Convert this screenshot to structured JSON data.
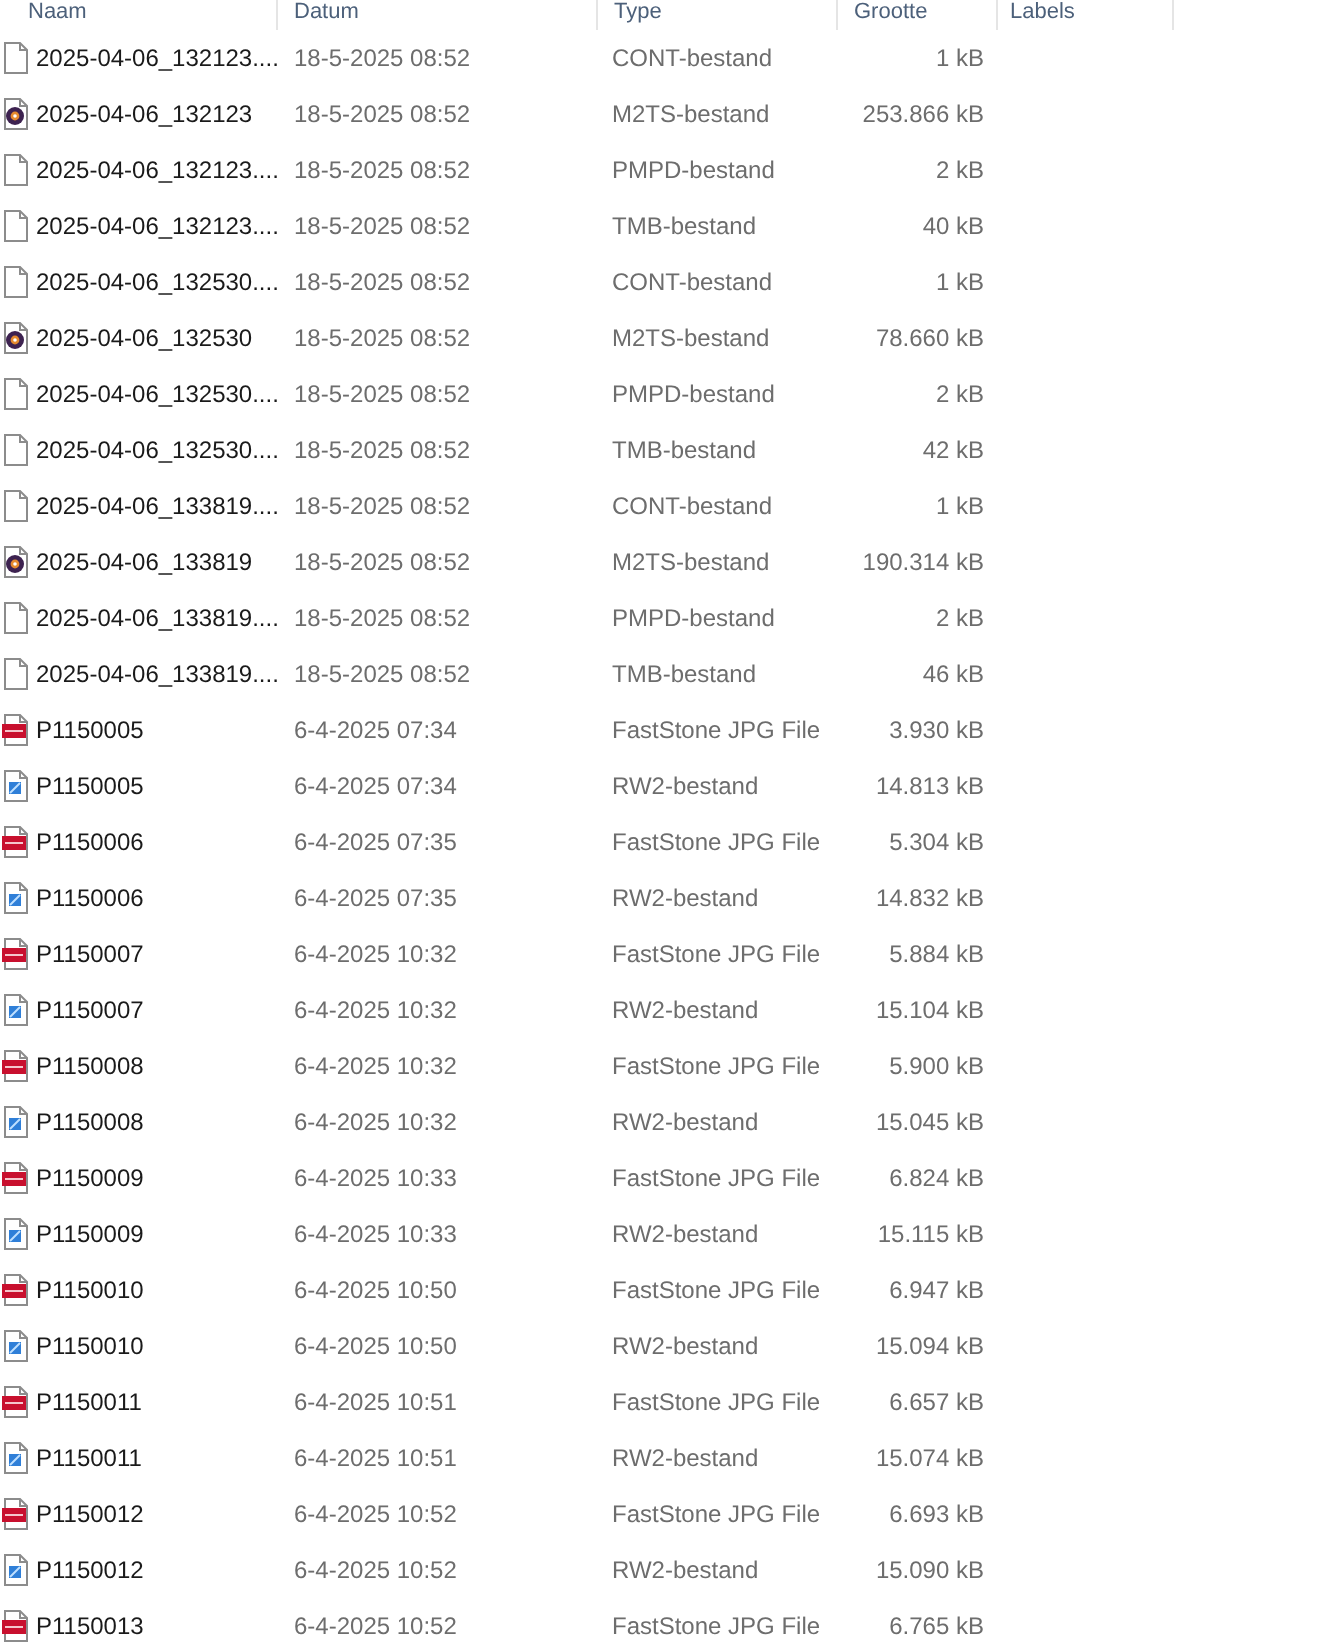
{
  "columns": [
    {
      "label": "Naam"
    },
    {
      "label": "Datum"
    },
    {
      "label": "Type"
    },
    {
      "label": "Grootte"
    },
    {
      "label": "Labels"
    }
  ],
  "rows": [
    {
      "kind": "blank",
      "name": "2025-04-06_132123....",
      "date": "18-5-2025 08:52",
      "type": "CONT-bestand",
      "size": "1 kB"
    },
    {
      "kind": "video",
      "name": "2025-04-06_132123",
      "date": "18-5-2025 08:52",
      "type": "M2TS-bestand",
      "size": "253.866 kB"
    },
    {
      "kind": "blank",
      "name": "2025-04-06_132123....",
      "date": "18-5-2025 08:52",
      "type": "PMPD-bestand",
      "size": "2 kB"
    },
    {
      "kind": "blank",
      "name": "2025-04-06_132123....",
      "date": "18-5-2025 08:52",
      "type": "TMB-bestand",
      "size": "40 kB"
    },
    {
      "kind": "blank",
      "name": "2025-04-06_132530....",
      "date": "18-5-2025 08:52",
      "type": "CONT-bestand",
      "size": "1 kB"
    },
    {
      "kind": "video",
      "name": "2025-04-06_132530",
      "date": "18-5-2025 08:52",
      "type": "M2TS-bestand",
      "size": "78.660 kB"
    },
    {
      "kind": "blank",
      "name": "2025-04-06_132530....",
      "date": "18-5-2025 08:52",
      "type": "PMPD-bestand",
      "size": "2 kB"
    },
    {
      "kind": "blank",
      "name": "2025-04-06_132530....",
      "date": "18-5-2025 08:52",
      "type": "TMB-bestand",
      "size": "42 kB"
    },
    {
      "kind": "blank",
      "name": "2025-04-06_133819....",
      "date": "18-5-2025 08:52",
      "type": "CONT-bestand",
      "size": "1 kB"
    },
    {
      "kind": "video",
      "name": "2025-04-06_133819",
      "date": "18-5-2025 08:52",
      "type": "M2TS-bestand",
      "size": "190.314 kB"
    },
    {
      "kind": "blank",
      "name": "2025-04-06_133819....",
      "date": "18-5-2025 08:52",
      "type": "PMPD-bestand",
      "size": "2 kB"
    },
    {
      "kind": "blank",
      "name": "2025-04-06_133819....",
      "date": "18-5-2025 08:52",
      "type": "TMB-bestand",
      "size": "46 kB"
    },
    {
      "kind": "jpg",
      "name": "P1150005",
      "date": "6-4-2025 07:34",
      "type": "FastStone JPG File",
      "size": "3.930 kB"
    },
    {
      "kind": "raw",
      "name": "P1150005",
      "date": "6-4-2025 07:34",
      "type": "RW2-bestand",
      "size": "14.813 kB"
    },
    {
      "kind": "jpg",
      "name": "P1150006",
      "date": "6-4-2025 07:35",
      "type": "FastStone JPG File",
      "size": "5.304 kB"
    },
    {
      "kind": "raw",
      "name": "P1150006",
      "date": "6-4-2025 07:35",
      "type": "RW2-bestand",
      "size": "14.832 kB"
    },
    {
      "kind": "jpg",
      "name": "P1150007",
      "date": "6-4-2025 10:32",
      "type": "FastStone JPG File",
      "size": "5.884 kB"
    },
    {
      "kind": "raw",
      "name": "P1150007",
      "date": "6-4-2025 10:32",
      "type": "RW2-bestand",
      "size": "15.104 kB"
    },
    {
      "kind": "jpg",
      "name": "P1150008",
      "date": "6-4-2025 10:32",
      "type": "FastStone JPG File",
      "size": "5.900 kB"
    },
    {
      "kind": "raw",
      "name": "P1150008",
      "date": "6-4-2025 10:32",
      "type": "RW2-bestand",
      "size": "15.045 kB"
    },
    {
      "kind": "jpg",
      "name": "P1150009",
      "date": "6-4-2025 10:33",
      "type": "FastStone JPG File",
      "size": "6.824 kB"
    },
    {
      "kind": "raw",
      "name": "P1150009",
      "date": "6-4-2025 10:33",
      "type": "RW2-bestand",
      "size": "15.115 kB"
    },
    {
      "kind": "jpg",
      "name": "P1150010",
      "date": "6-4-2025 10:50",
      "type": "FastStone JPG File",
      "size": "6.947 kB"
    },
    {
      "kind": "raw",
      "name": "P1150010",
      "date": "6-4-2025 10:50",
      "type": "RW2-bestand",
      "size": "15.094 kB"
    },
    {
      "kind": "jpg",
      "name": "P1150011",
      "date": "6-4-2025 10:51",
      "type": "FastStone JPG File",
      "size": "6.657 kB"
    },
    {
      "kind": "raw",
      "name": "P1150011",
      "date": "6-4-2025 10:51",
      "type": "RW2-bestand",
      "size": "15.074 kB"
    },
    {
      "kind": "jpg",
      "name": "P1150012",
      "date": "6-4-2025 10:52",
      "type": "FastStone JPG File",
      "size": "6.693 kB"
    },
    {
      "kind": "raw",
      "name": "P1150012",
      "date": "6-4-2025 10:52",
      "type": "RW2-bestand",
      "size": "15.090 kB"
    },
    {
      "kind": "jpg",
      "name": "P1150013",
      "date": "6-4-2025 10:52",
      "type": "FastStone JPG File",
      "size": "6.765 kB"
    }
  ]
}
